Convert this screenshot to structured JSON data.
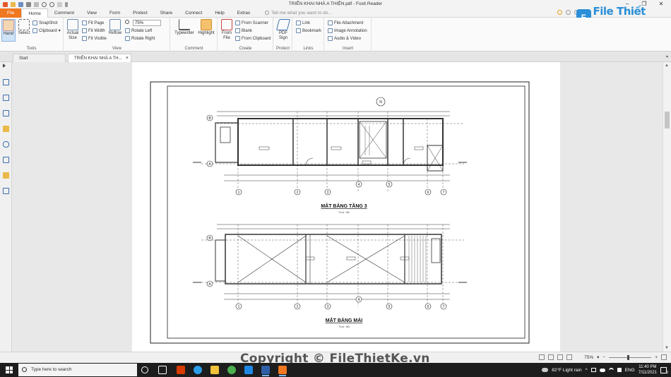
{
  "window": {
    "title": "TRIỂN KHAI NHÀ A THIỆN.pdf - Foxit Reader",
    "controls": [
      "–",
      "❐",
      "✕"
    ]
  },
  "menu": {
    "tabs": [
      "File",
      "Home",
      "Comment",
      "View",
      "Form",
      "Protect",
      "Share",
      "Connect",
      "Help",
      "Extras"
    ],
    "tell_me": "Tell me what you want to do..."
  },
  "logo": {
    "text": "File Thiết Kế.vn",
    "badge": "F"
  },
  "ribbon": {
    "tools": {
      "label": "Tools",
      "hand": "Hand",
      "select": "Select",
      "snapshot": "SnapShot",
      "clipboard": "Clipboard"
    },
    "view": {
      "label": "View",
      "actual_size": "Actual Size",
      "fit_page": "Fit Page",
      "fit_width": "Fit Width",
      "fit_visible": "Fit Visible",
      "reflow": "Reflow",
      "zoom": "75%",
      "rotate_left": "Rotate Left",
      "rotate_right": "Rotate Right"
    },
    "comment": {
      "label": "Comment",
      "typewriter": "Typewriter",
      "highlight": "Highlight"
    },
    "create": {
      "label": "Create",
      "from_file": "From File",
      "from_scanner": "From Scanner",
      "blank": "Blank",
      "from_clipboard": "From Clipboard"
    },
    "protect": {
      "label": "Protect",
      "pdf_sign": "PDF Sign"
    },
    "links": {
      "label": "Links",
      "link": "Link",
      "bookmark": "Bookmark"
    },
    "insert": {
      "label": "Insert",
      "file_attachment": "File Attachment",
      "image_annotation": "Image Annotation",
      "audio_video": "Audio & Video"
    }
  },
  "doc_tabs": [
    {
      "label": "Start"
    },
    {
      "label": "TRIỂN KHAI NHÀ A TH..."
    }
  ],
  "drawing": {
    "plan1_title": "MẶT BẰNG TẦNG 3",
    "plan1_scale": "TLci : 80",
    "plan2_title": "MẶT BẰNG MÁI",
    "plan2_scale": "TLci : 80",
    "north_label": "N",
    "grid_numbers": [
      "1",
      "2",
      "3",
      "4",
      "5",
      "6",
      "7"
    ],
    "grid_letters": [
      "B",
      "A"
    ]
  },
  "watermark": "Copyright © FileThietKe.vn",
  "status": {
    "zoom": "75%"
  },
  "taskbar": {
    "search_placeholder": "Type here to search",
    "weather": "82°F  Light rain",
    "lang": "ENG",
    "time": "11:40 PM",
    "date": "7/11/2021",
    "notif_count": "3"
  },
  "colors": {
    "accent": "#f07820",
    "brand": "#2a8fd8",
    "taskbar": "#1d1d1d"
  }
}
